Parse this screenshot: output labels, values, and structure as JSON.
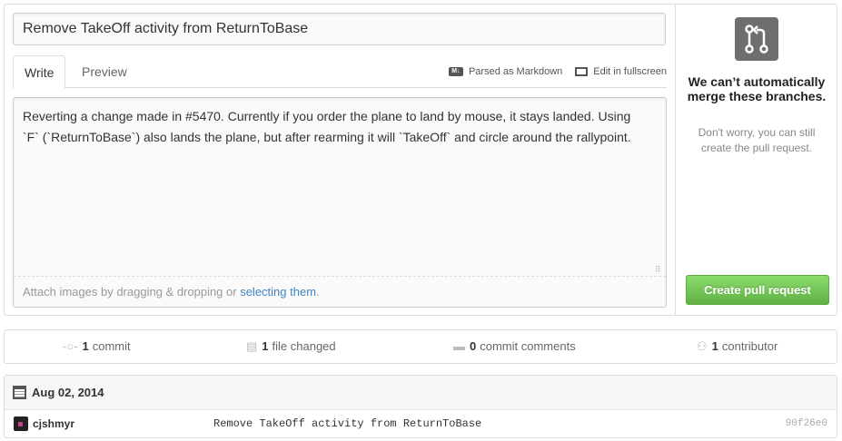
{
  "form": {
    "title_value": "Remove TakeOff activity from ReturnToBase",
    "tabs": [
      {
        "label": "Write"
      },
      {
        "label": "Preview"
      }
    ],
    "tools": {
      "markdown_label": "Parsed as Markdown",
      "fullscreen_label": "Edit in fullscreen"
    },
    "body_line1": "Reverting a change made in #5470. Currently if you order the plane to land by mouse, it stays landed. Using",
    "body_line2": "`F` (`ReturnToBase`) also lands the plane, but after rearming it will `TakeOff` and circle around the rallypoint.",
    "attach_prefix": "Attach images by dragging & dropping or ",
    "attach_link": "selecting them",
    "attach_suffix": "."
  },
  "merge": {
    "icon": "git-pull-request-icon",
    "title": "We can’t automatically merge these branches.",
    "description": "Don't worry, you can still create the pull request.",
    "create_button": "Create pull request"
  },
  "summary": {
    "commits_count": "1",
    "commits_label": "commit",
    "files_count": "1",
    "files_label": "file changed",
    "comments_count": "0",
    "comments_label": "commit comments",
    "contributors_count": "1",
    "contributors_label": "contributor"
  },
  "commits": {
    "date": "Aug 02, 2014",
    "items": [
      {
        "author": "cjshmyr",
        "message": "Remove TakeOff activity from ReturnToBase",
        "sha": "90f26e0"
      }
    ]
  },
  "colors": {
    "accent_green": "#60b044",
    "link_blue": "#4183c4"
  }
}
